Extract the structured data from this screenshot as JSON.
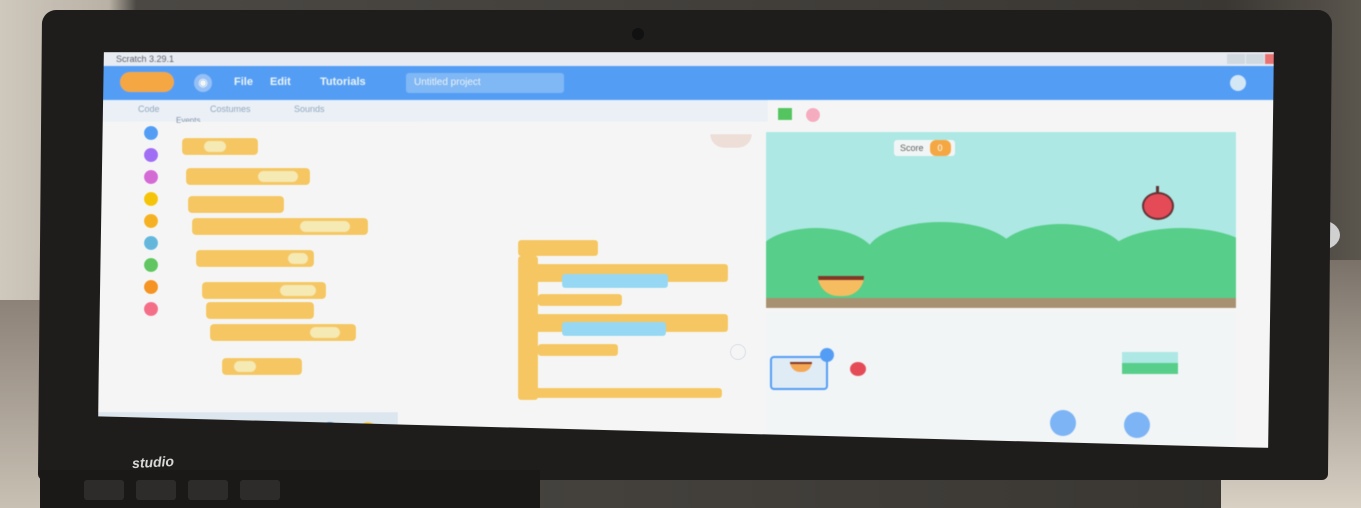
{
  "window": {
    "title": "Scratch 3.29.1"
  },
  "menubar": {
    "logo_alt": "Scratch logo",
    "language_icon": "globe-icon",
    "file": "File",
    "edit": "Edit",
    "tutorials": "Tutorials",
    "project_title": "Untitled project"
  },
  "tabs": {
    "code": "Code",
    "costumes": "Costumes",
    "sounds": "Sounds"
  },
  "palette": {
    "heading": "Events"
  },
  "stage": {
    "score_label": "Score",
    "score_value": "0"
  },
  "sprites": {
    "items": [
      "Bowl",
      "Apple"
    ]
  },
  "laptop": {
    "brand": "studio"
  },
  "colors": {
    "menubar": "#4c97ff",
    "events_block": "#f1c15a",
    "sensing_block": "#8fd3ef",
    "stage_sky": "#a7e3df",
    "grass": "#4fc982"
  }
}
